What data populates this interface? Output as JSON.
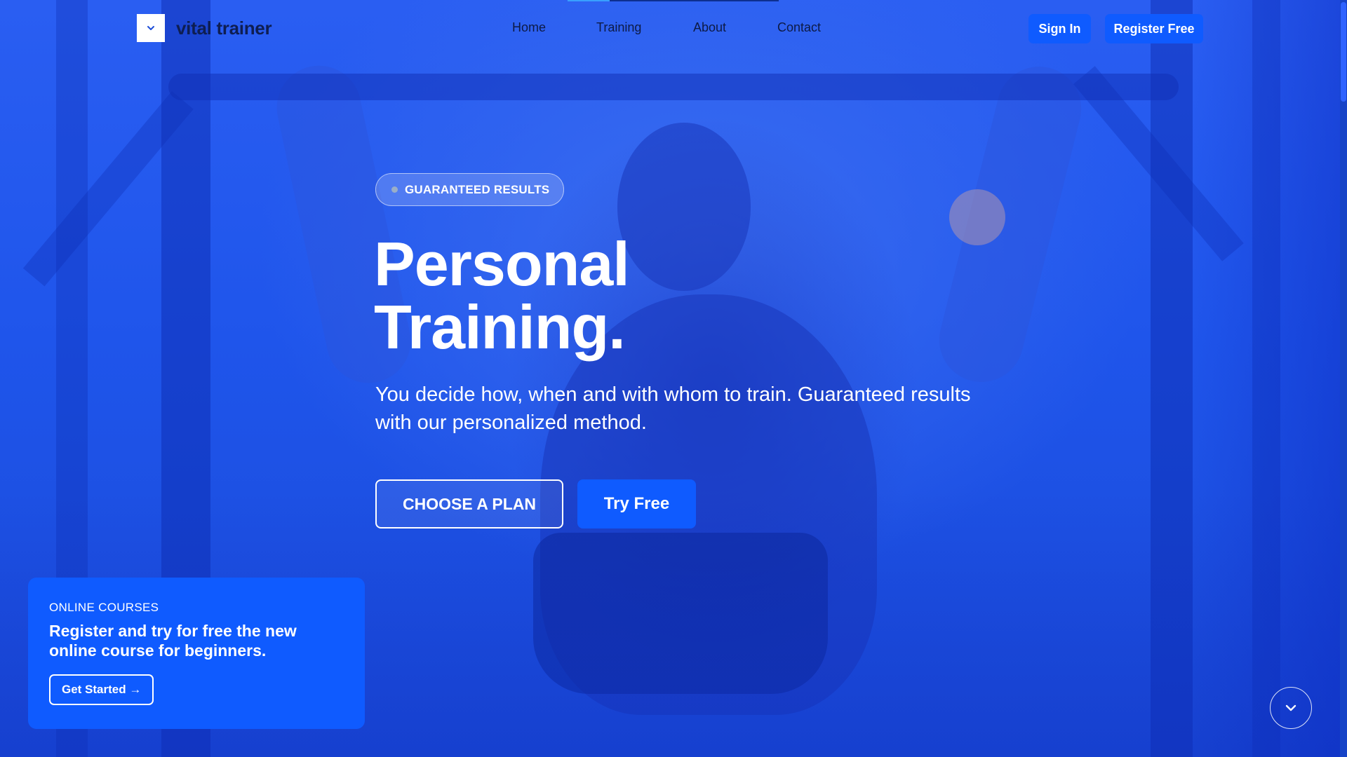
{
  "brand": {
    "name": "vital trainer",
    "logo_icon": "chevron-down-icon"
  },
  "nav": {
    "items": [
      {
        "label": "Home"
      },
      {
        "label": "Training"
      },
      {
        "label": "About"
      },
      {
        "label": "Contact"
      }
    ]
  },
  "header": {
    "sign_in_label": "Sign In",
    "register_label": "Register Free"
  },
  "hero": {
    "badge": "GUARANTEED RESULTS",
    "title_line1": "Personal",
    "title_line2": "Training.",
    "subtitle": "You decide how, when and with whom to train. Guaranteed results with our personalized method.",
    "primary_cta": "CHOOSE A PLAN",
    "secondary_cta": "Try Free"
  },
  "promo": {
    "eyebrow": "ONLINE COURSES",
    "text": "Register and try for free the new online course for beginners.",
    "cta": "Get Started →"
  },
  "scroll_button": {
    "icon": "chevron-down-icon"
  },
  "colors": {
    "accent": "#0f5bff",
    "overlay": "#1d52e8",
    "text_dark": "#0e1e52",
    "text_light": "#ffffff"
  }
}
